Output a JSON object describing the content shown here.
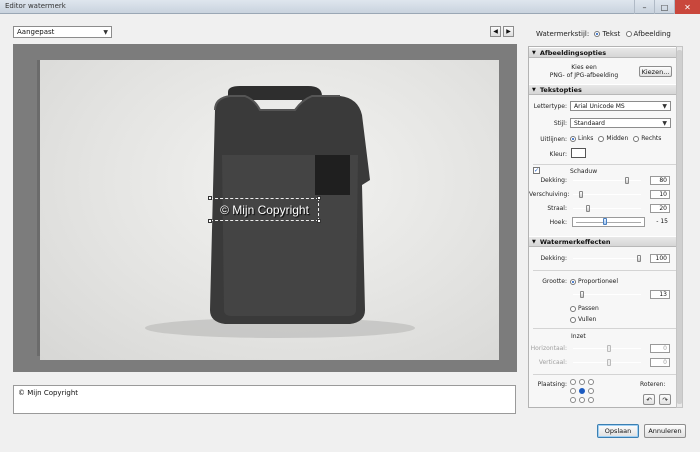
{
  "window": {
    "title": "Editor watermerk"
  },
  "preset": {
    "value": "Aangepast"
  },
  "style_selector": {
    "label": "Watermerkstijl:",
    "options": [
      "Tekst",
      "Afbeelding"
    ],
    "selected": "Tekst"
  },
  "watermark_preview": {
    "text": "© Mijn Copyright"
  },
  "text_input": {
    "value": "© Mijn Copyright"
  },
  "image_options": {
    "header": "Afbeeldingsopties",
    "hint_line1": "Kies een",
    "hint_line2": "PNG- of JPG-afbeelding",
    "choose_button": "Kiezen..."
  },
  "text_options": {
    "header": "Tekstopties",
    "font_label": "Lettertype:",
    "font_value": "Arial Unicode MS",
    "style_label": "Stijl:",
    "style_value": "Standaard",
    "align_label": "Uitlijnen:",
    "align_options": [
      "Links",
      "Midden",
      "Rechts"
    ],
    "align_selected": "Links",
    "color_label": "Kleur:",
    "color_value": "#ffffff"
  },
  "shadow": {
    "checked": true,
    "label": "Schaduw",
    "opacity_label": "Dekking:",
    "opacity_value": "80",
    "offset_label": "Verschuiving:",
    "offset_value": "10",
    "radius_label": "Straal:",
    "radius_value": "20",
    "angle_label": "Hoek:",
    "angle_value": "- 15"
  },
  "effects": {
    "header": "Watermerkeffecten",
    "opacity_label": "Dekking:",
    "opacity_value": "100",
    "size_label": "Grootte:",
    "size_options": [
      "Proportioneel",
      "Passen",
      "Vullen"
    ],
    "size_selected": "Proportioneel",
    "size_value": "13",
    "inset_label": "Inzet",
    "horizontal_label": "Horizontaal:",
    "horizontal_value": "0",
    "vertical_label": "Verticaal:",
    "vertical_value": "0",
    "anchor_label": "Plaatsing:",
    "rotate_label": "Roteren:"
  },
  "footer": {
    "save": "Opslaan",
    "cancel": "Annuleren"
  },
  "nav": {
    "prev": "◀",
    "next": "▶"
  },
  "glyphs": {
    "minimize": "–",
    "maximize": "□",
    "close": "✕",
    "dropdown": "▼",
    "collapse": "▼",
    "check": "✓",
    "rotate_ccw": "↶",
    "rotate_cw": "↷"
  }
}
